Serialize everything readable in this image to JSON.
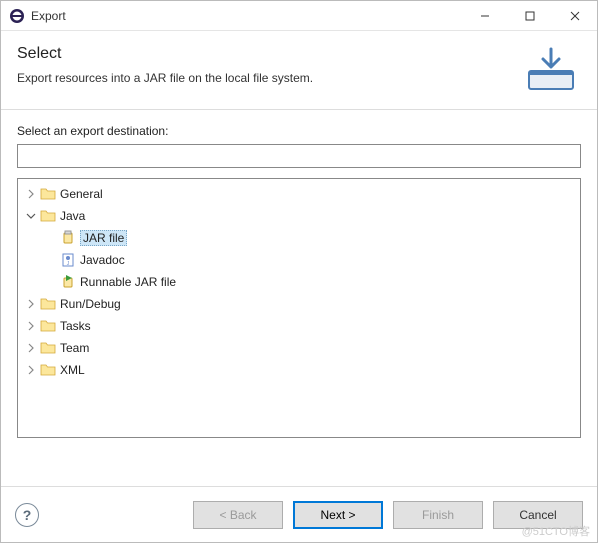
{
  "window": {
    "title": "Export",
    "minimize": "—",
    "maximize": "□",
    "close": "✕"
  },
  "header": {
    "title": "Select",
    "description": "Export resources into a JAR file on the local file system."
  },
  "filter": {
    "label": "Select an export destination:",
    "value": ""
  },
  "tree": [
    {
      "label": "General",
      "level": 1,
      "expandable": true,
      "expanded": false,
      "icon": "folder",
      "selected": false
    },
    {
      "label": "Java",
      "level": 1,
      "expandable": true,
      "expanded": true,
      "icon": "folder",
      "selected": false
    },
    {
      "label": "JAR file",
      "level": 2,
      "expandable": false,
      "expanded": false,
      "icon": "jar",
      "selected": true
    },
    {
      "label": "Javadoc",
      "level": 2,
      "expandable": false,
      "expanded": false,
      "icon": "javadoc",
      "selected": false
    },
    {
      "label": "Runnable JAR file",
      "level": 2,
      "expandable": false,
      "expanded": false,
      "icon": "runjar",
      "selected": false
    },
    {
      "label": "Run/Debug",
      "level": 1,
      "expandable": true,
      "expanded": false,
      "icon": "folder",
      "selected": false
    },
    {
      "label": "Tasks",
      "level": 1,
      "expandable": true,
      "expanded": false,
      "icon": "folder",
      "selected": false
    },
    {
      "label": "Team",
      "level": 1,
      "expandable": true,
      "expanded": false,
      "icon": "folder",
      "selected": false
    },
    {
      "label": "XML",
      "level": 1,
      "expandable": true,
      "expanded": false,
      "icon": "folder",
      "selected": false
    }
  ],
  "buttons": {
    "back": "< Back",
    "next": "Next >",
    "finish": "Finish",
    "cancel": "Cancel"
  },
  "watermark": "@51CTO博客"
}
